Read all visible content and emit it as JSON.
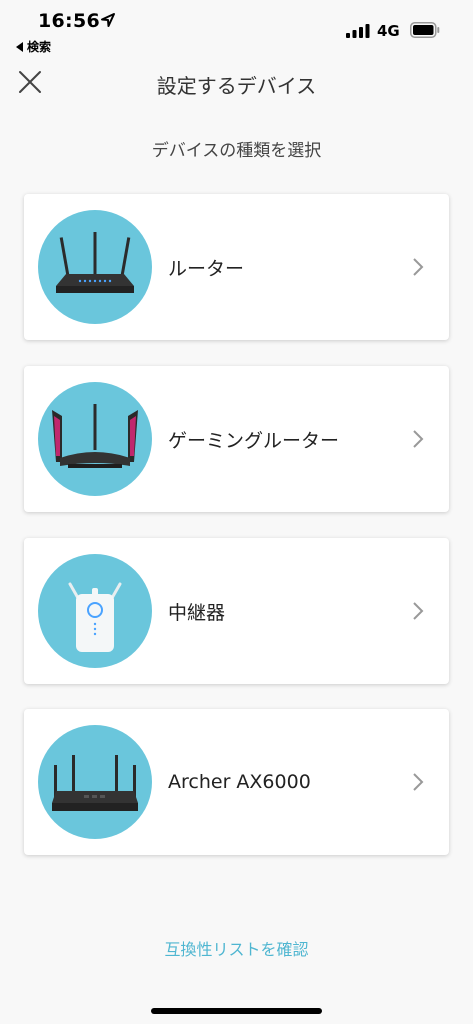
{
  "status_bar": {
    "time": "16:56",
    "back_app": "検索",
    "network": "4G"
  },
  "header": {
    "title": "設定するデバイス",
    "close_icon": "close-icon"
  },
  "subtitle": "デバイスの種類を選択",
  "devices": [
    {
      "label": "ルーター",
      "icon": "router-icon"
    },
    {
      "label": "ゲーミングルーター",
      "icon": "gaming-router-icon"
    },
    {
      "label": "中継器",
      "icon": "range-extender-icon"
    },
    {
      "label": "Archer AX6000",
      "icon": "archer-ax6000-icon"
    }
  ],
  "footer": {
    "compat_link": "互換性リストを確認"
  },
  "colors": {
    "accent": "#4fb6d1",
    "icon_circle": "#6ac6dc",
    "background": "#f8f8f8"
  }
}
